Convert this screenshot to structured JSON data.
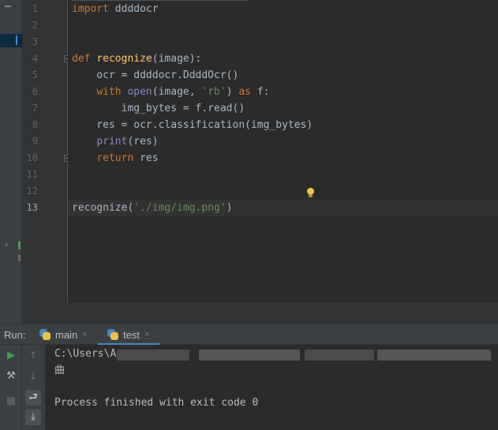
{
  "editor": {
    "line_numbers": [
      "1",
      "2",
      "3",
      "4",
      "5",
      "6",
      "7",
      "8",
      "9",
      "10",
      "11",
      "12",
      "13"
    ],
    "current_line": "13",
    "code": {
      "l1_kw": "import",
      "l1_rest": " ddddocr",
      "l4_kw": "def",
      "l4_fn": "recognize",
      "l4_rest": "(image):",
      "l5": "    ocr = ddddocr.DdddOcr()",
      "l6_kw": "with",
      "l6_bi": "open",
      "l6_a": "(image, ",
      "l6_str": "'rb'",
      "l6_b": ") ",
      "l6_as": "as",
      "l6_c": " f:",
      "l7": "        img_bytes = f.read()",
      "l8": "    res = ocr.classification(img_bytes)",
      "l9_bi": "print",
      "l9_rest": "(res)",
      "l10_kw": "return",
      "l10_rest": " res",
      "l13_a": "recognize(",
      "l13_str": "'./img/img.png'",
      "l13_b": ")"
    }
  },
  "run_panel": {
    "label": "Run:",
    "tabs": [
      {
        "label": "main",
        "close": "×"
      },
      {
        "label": "test",
        "close": "×"
      }
    ],
    "active_tab": "test",
    "console": {
      "path_line": "C:\\Users\\A",
      "output_char": "曲",
      "finished": "Process finished with exit code 0"
    }
  },
  "colors": {
    "keyword": "#cc7832",
    "function": "#ffc66d",
    "builtin": "#8888c6",
    "string": "#6a8759",
    "run_green": "#499c54",
    "accent_blue": "#4a88c7"
  },
  "icons": [
    "run-icon",
    "wrench-icon",
    "stop-icon",
    "scroll-up-icon",
    "scroll-down-icon",
    "soft-wrap-icon",
    "scroll-to-end-icon",
    "python-file-icon",
    "close-icon",
    "lightbulb-icon",
    "fold-icon",
    "expand-chevron-icon"
  ]
}
